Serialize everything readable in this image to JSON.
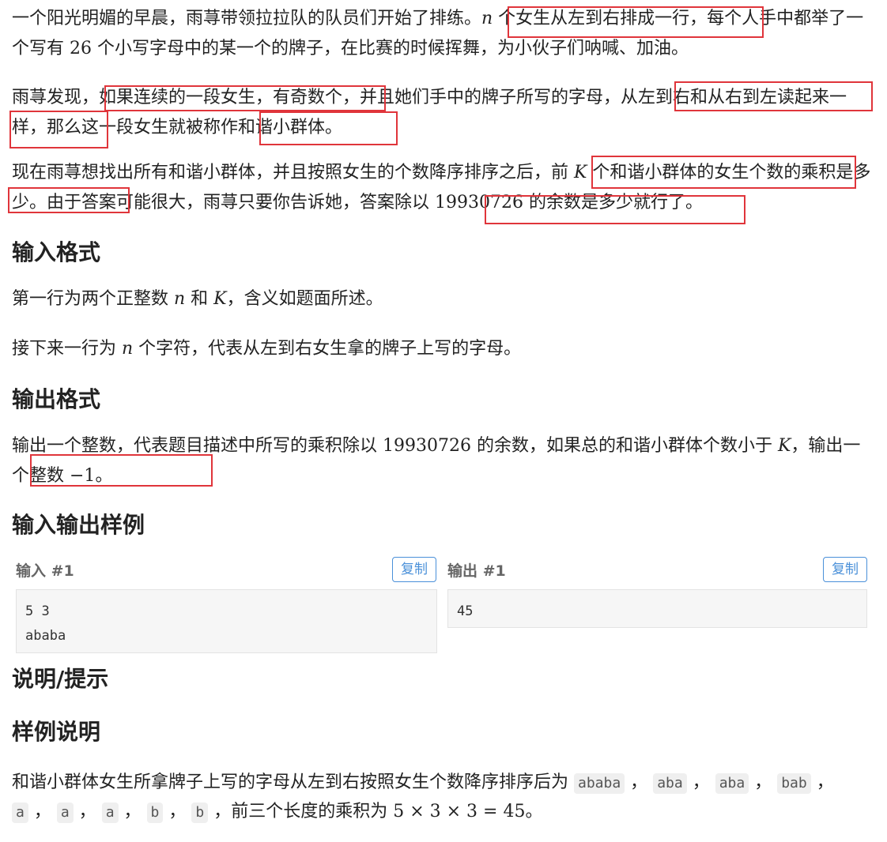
{
  "problem": {
    "p1_a": "一个阳光明媚的早晨，雨荨带领拉拉队的队员们开始了排练。",
    "p1_var_n": "n",
    "p1_b": " 个女生从左到右排成一行，每个人手中都举了一个写有 ",
    "p1_num": "26",
    "p1_c": " 个小写字母中的某一个的牌子，在比赛的时候挥舞，为小伙子们呐喊、加油。",
    "p2": "雨荨发现，如果连续的一段女生，有奇数个，并且她们手中的牌子所写的字母，从左到右和从右到左读起来一样，那么这一段女生就被称作和谐小群体。",
    "p3_a": "现在雨荨想找出所有和谐小群体，并且按照女生的个数降序排序之后，前 ",
    "p3_var_k": "K",
    "p3_b": " 个和谐小群体的女生个数的乘积是多少。由于答案可能很大，雨荨只要你告诉她，答案除以 ",
    "p3_mod": "19930726",
    "p3_c": " 的余数是多少就行了。"
  },
  "input_format": {
    "heading": "输入格式",
    "line1_a": "第一行为两个正整数 ",
    "line1_n": "n",
    "line1_b": " 和 ",
    "line1_k": "K",
    "line1_c": "，含义如题面所述。",
    "line2_a": "接下来一行为 ",
    "line2_n": "n",
    "line2_b": " 个字符，代表从左到右女生拿的牌子上写的字母。"
  },
  "output_format": {
    "heading": "输出格式",
    "text_a": "输出一个整数，代表题目描述中所写的乘积除以 ",
    "mod": "19930726",
    "text_b": " 的余数，如果总的和谐小群体个数小于 ",
    "k": "K",
    "text_c": "，输出一个整数 ",
    "neg_one": "−1",
    "text_d": "。"
  },
  "samples": {
    "heading": "输入输出样例",
    "input_label": "输入 #1",
    "output_label": "输出 #1",
    "copy_label": "复制",
    "input_content": "5 3\nababa",
    "output_content": "45"
  },
  "hint": {
    "heading": "说明/提示",
    "subheading": "样例说明",
    "text_a": "和谐小群体女生所拿牌子上写的字母从左到右按照女生个数降序排序后为 ",
    "chips": [
      "ababa",
      "aba",
      "aba",
      "bab",
      "a",
      "a",
      "a",
      "b",
      "b"
    ],
    "text_b": "，前三个长度的乘积为 ",
    "formula": "5 × 3 × 3 = 45",
    "text_c": "。"
  },
  "colors": {
    "highlight": "#e0353b",
    "copy_button": "#4a90d9"
  }
}
